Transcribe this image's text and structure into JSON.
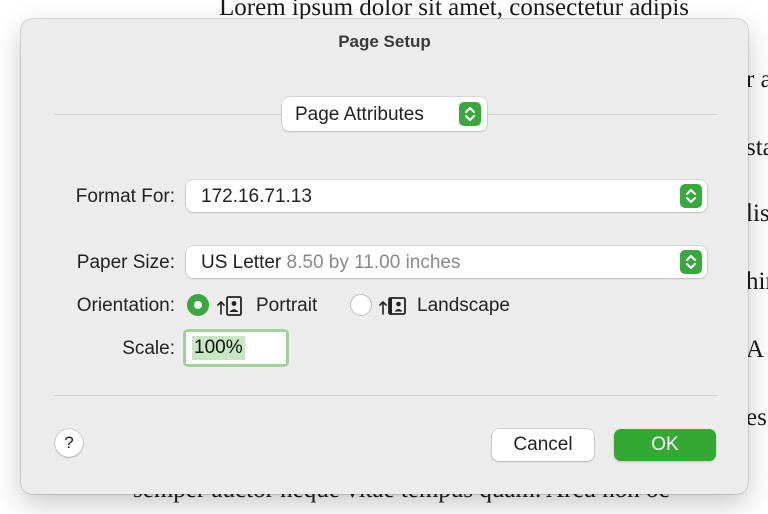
{
  "document": {
    "top_line": "Lorem ipsum dolor sit amet, consectetur adipis",
    "bottom_line": "semper auctor neque vitae tempus quam. Arcu non oc",
    "right_fragments": [
      "r a",
      "sta",
      "lis",
      "hir",
      "A",
      "es"
    ]
  },
  "dialog": {
    "title": "Page Setup",
    "section_popup": "Page Attributes",
    "format_for": {
      "label": "Format For:",
      "value": "172.16.71.13"
    },
    "paper_size": {
      "label": "Paper Size:",
      "value": "US Letter",
      "detail": "8.50 by 11.00 inches"
    },
    "orientation": {
      "label": "Orientation:",
      "options": [
        {
          "label": "Portrait",
          "selected": true
        },
        {
          "label": "Landscape",
          "selected": false
        }
      ]
    },
    "scale": {
      "label": "Scale:",
      "value": "100%"
    },
    "help_label": "?",
    "cancel_label": "Cancel",
    "ok_label": "OK"
  },
  "colors": {
    "accent": "#3aa83f",
    "ok_button": "#33a832",
    "sheet_bg": "#ececec"
  },
  "icons": [
    "chevron-up-down-icon",
    "portrait-orientation-icon",
    "landscape-orientation-icon"
  ]
}
